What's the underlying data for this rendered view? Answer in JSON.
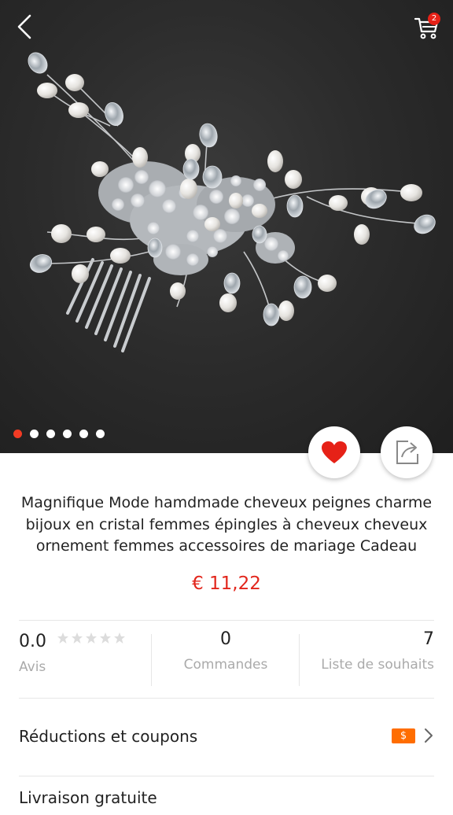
{
  "header": {
    "cart_count": "2",
    "back_icon": "back-arrow-icon",
    "cart_icon": "shopping-cart-icon"
  },
  "gallery": {
    "image_count": 6,
    "active_index": 0
  },
  "product": {
    "title": "Magnifique Mode hamdmade cheveux peignes charme bijoux en cristal femmes épingles à cheveux cheveux ornement femmes accessoires de mariage Cadeau",
    "price": "€ 11,22"
  },
  "stats": {
    "rating_value": "0.0",
    "rating_label": "Avis",
    "orders_value": "0",
    "orders_label": "Commandes",
    "wishlist_value": "7",
    "wishlist_label": "Liste de souhaits"
  },
  "rows": {
    "coupons_label": "Réductions et coupons",
    "coupon_badge": "$",
    "shipping_label": "Livraison gratuite"
  },
  "colors": {
    "accent": "#e2261c",
    "coupon": "#ff6d00"
  }
}
